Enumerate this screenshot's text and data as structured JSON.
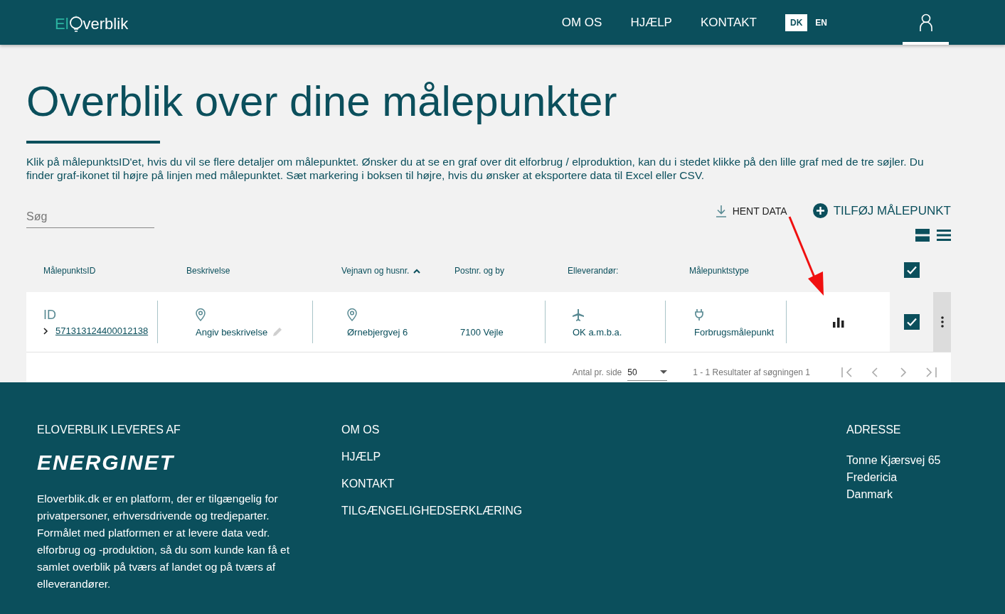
{
  "header": {
    "logo": {
      "prefix": "El",
      "suffix": "verblik"
    },
    "nav": [
      "OM OS",
      "HJÆLP",
      "KONTAKT"
    ],
    "languages": [
      {
        "label": "DK",
        "selected": true
      },
      {
        "label": "EN",
        "selected": false
      }
    ]
  },
  "title": "Overblik over dine målepunkter",
  "description": "Klik på målepunktsID'et, hvis du vil se flere detaljer om målepunktet. Ønsker du at se en graf over dit elforbrug / elproduktion, kan du i stedet klikke på den lille graf med de tre søjler. Du finder graf-ikonet til højre på linjen med målepunktet. Sæt markering i boksen til højre, hvis du ønsker at eksportere data til Excel eller CSV.",
  "search": {
    "placeholder": "Søg"
  },
  "actions": [
    {
      "kind": "download",
      "label": "HENT DATA"
    },
    {
      "kind": "add",
      "label": "TILFØJ MÅLEPUNKT"
    }
  ],
  "table": {
    "columns": [
      {
        "label": "MålepunktsID",
        "sorted": false
      },
      {
        "label": "Beskrivelse",
        "sorted": false
      },
      {
        "label": "Vejnavn og husnr.",
        "sorted": true
      },
      {
        "label": "Postnr. og by",
        "sorted": false
      },
      {
        "label": "Elleverandør:",
        "sorted": false
      },
      {
        "label": "Målepunktstype",
        "sorted": false
      }
    ],
    "select_all": {
      "checked": true
    },
    "rows": [
      {
        "id_label": "ID",
        "id": "571313124400012138",
        "description_placeholder": "Angiv beskrivelse",
        "street": "Ørnebjergvej 6",
        "postal": "7100 Vejle",
        "supplier": "OK a.m.b.a.",
        "type": "Forbrugsmålepunkt",
        "checked": true
      }
    ],
    "pagination": {
      "per_page_label": "Antal pr. side",
      "per_page": "50",
      "results": "1 - 1 Resultater af søgningen 1"
    }
  },
  "footer": {
    "provider": {
      "heading": "ELOVERBLIK LEVERES AF",
      "logo": "ENERGINET",
      "text": "Eloverblik.dk er en platform, der er tilgængelig for privatpersoner, erhversdrivende og tredjeparter. Formålet med platformen er at levere data vedr. elforbrug og -produktion, så du som kunde kan få et samlet overblik på tværs af landet og på tværs af elleverandører."
    },
    "links": [
      "OM OS",
      "HJÆLP",
      "KONTAKT",
      "TILGÆNGELIGHEDSERKLÆRING"
    ],
    "address": {
      "heading": "ADRESSE",
      "lines": [
        "Tonne Kjærsvej 65",
        "Fredericia",
        "Danmark"
      ]
    }
  }
}
